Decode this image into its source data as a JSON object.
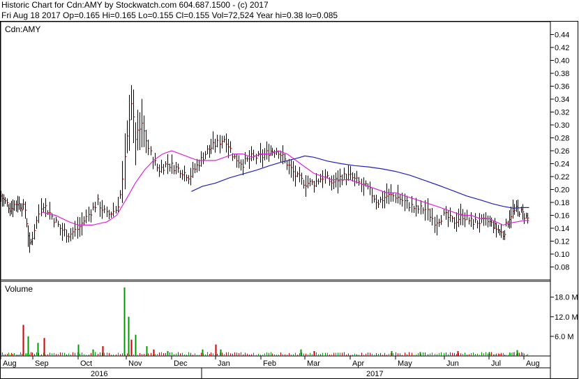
{
  "header": {
    "line1": "Historic Chart for Cdn:AMY by Stockwatch.com 604.687.1500 - (c) 2017",
    "line2": "Fri Aug 18 2017   Op=0.165  Hi=0.165  Lo=0.155  Cl=0.155  Vol=72,524  Year hi=0.38  lo=0.085"
  },
  "chart_data": {
    "type": "ohlc",
    "symbol_label": "Cdn:AMY",
    "volume_label": "Volume",
    "price_axis": {
      "ylim": [
        0.06,
        0.46
      ],
      "ticks": [
        "0.44",
        "0.42",
        "0.40",
        "0.38",
        "0.36",
        "0.34",
        "0.32",
        "0.30",
        "0.28",
        "0.26",
        "0.24",
        "0.22",
        "0.20",
        "0.18",
        "0.16",
        "0.14",
        "0.12",
        "0.10",
        "0.08"
      ]
    },
    "volume_axis": {
      "ylim": [
        0,
        22
      ],
      "ticks": [
        "18.0 M",
        "12.0 M",
        "6.0 M"
      ]
    },
    "x_axis": {
      "months": [
        "Aug",
        "Sep",
        "Oct",
        "Nov",
        "Dec",
        "Jan",
        "Feb",
        "Mar",
        "Apr",
        "May",
        "Jun",
        "Jul",
        "Aug"
      ],
      "years": [
        "2016",
        "2017"
      ]
    },
    "colors": {
      "up_bar": "#000000",
      "down_tick": "#cc0000",
      "ma_short": "#e020e0",
      "ma_long": "#2020c0",
      "volume_up": "#009900",
      "volume_down": "#cc0000"
    },
    "price_anchors_month_value": [
      [
        0.0,
        0.19
      ],
      [
        0.3,
        0.17
      ],
      [
        0.5,
        0.18
      ],
      [
        0.75,
        0.17
      ],
      [
        0.9,
        0.11
      ],
      [
        1.0,
        0.13
      ],
      [
        1.2,
        0.18
      ],
      [
        1.4,
        0.16
      ],
      [
        1.6,
        0.14
      ],
      [
        1.8,
        0.13
      ],
      [
        2.0,
        0.14
      ],
      [
        2.2,
        0.16
      ],
      [
        2.4,
        0.18
      ],
      [
        2.6,
        0.16
      ],
      [
        2.8,
        0.17
      ],
      [
        2.9,
        0.2
      ],
      [
        3.0,
        0.27
      ],
      [
        3.1,
        0.34
      ],
      [
        3.2,
        0.28
      ],
      [
        3.35,
        0.3
      ],
      [
        3.5,
        0.26
      ],
      [
        3.7,
        0.23
      ],
      [
        3.9,
        0.24
      ],
      [
        4.2,
        0.23
      ],
      [
        4.4,
        0.22
      ],
      [
        4.6,
        0.24
      ],
      [
        4.8,
        0.26
      ],
      [
        5.0,
        0.27
      ],
      [
        5.2,
        0.28
      ],
      [
        5.4,
        0.25
      ],
      [
        5.6,
        0.24
      ],
      [
        5.8,
        0.25
      ],
      [
        6.0,
        0.25
      ],
      [
        6.2,
        0.26
      ],
      [
        6.4,
        0.26
      ],
      [
        6.6,
        0.24
      ],
      [
        6.8,
        0.22
      ],
      [
        7.0,
        0.21
      ],
      [
        7.2,
        0.21
      ],
      [
        7.4,
        0.22
      ],
      [
        7.6,
        0.21
      ],
      [
        7.8,
        0.22
      ],
      [
        8.0,
        0.22
      ],
      [
        8.2,
        0.21
      ],
      [
        8.4,
        0.2
      ],
      [
        8.6,
        0.18
      ],
      [
        8.8,
        0.19
      ],
      [
        9.0,
        0.19
      ],
      [
        9.2,
        0.18
      ],
      [
        9.4,
        0.17
      ],
      [
        9.6,
        0.17
      ],
      [
        9.8,
        0.15
      ],
      [
        10.0,
        0.16
      ],
      [
        10.2,
        0.15
      ],
      [
        10.4,
        0.16
      ],
      [
        10.6,
        0.15
      ],
      [
        10.8,
        0.15
      ],
      [
        11.0,
        0.15
      ],
      [
        11.2,
        0.14
      ],
      [
        11.4,
        0.13
      ],
      [
        11.6,
        0.16
      ],
      [
        11.8,
        0.17
      ],
      [
        12.0,
        0.16
      ],
      [
        12.1,
        0.155
      ]
    ],
    "ma_short_month_value": [
      [
        1.2,
        0.165
      ],
      [
        1.5,
        0.16
      ],
      [
        1.8,
        0.15
      ],
      [
        2.0,
        0.145
      ],
      [
        2.3,
        0.145
      ],
      [
        2.6,
        0.15
      ],
      [
        2.8,
        0.16
      ],
      [
        3.0,
        0.185
      ],
      [
        3.2,
        0.21
      ],
      [
        3.4,
        0.23
      ],
      [
        3.6,
        0.245
      ],
      [
        3.8,
        0.255
      ],
      [
        4.0,
        0.26
      ],
      [
        4.2,
        0.255
      ],
      [
        4.4,
        0.25
      ],
      [
        4.6,
        0.245
      ],
      [
        4.8,
        0.245
      ],
      [
        5.0,
        0.245
      ],
      [
        5.2,
        0.25
      ],
      [
        5.4,
        0.255
      ],
      [
        5.6,
        0.255
      ],
      [
        5.8,
        0.25
      ],
      [
        6.0,
        0.255
      ],
      [
        6.2,
        0.255
      ],
      [
        6.4,
        0.26
      ],
      [
        6.6,
        0.255
      ],
      [
        6.8,
        0.245
      ],
      [
        7.0,
        0.235
      ],
      [
        7.2,
        0.225
      ],
      [
        7.4,
        0.22
      ],
      [
        7.6,
        0.215
      ],
      [
        7.8,
        0.215
      ],
      [
        8.0,
        0.215
      ],
      [
        8.2,
        0.21
      ],
      [
        8.4,
        0.205
      ],
      [
        8.6,
        0.2
      ],
      [
        8.8,
        0.195
      ],
      [
        9.0,
        0.195
      ],
      [
        9.2,
        0.19
      ],
      [
        9.4,
        0.185
      ],
      [
        9.6,
        0.18
      ],
      [
        9.8,
        0.175
      ],
      [
        10.0,
        0.17
      ],
      [
        10.2,
        0.165
      ],
      [
        10.4,
        0.16
      ],
      [
        10.6,
        0.16
      ],
      [
        10.8,
        0.155
      ],
      [
        11.0,
        0.155
      ],
      [
        11.2,
        0.15
      ],
      [
        11.4,
        0.145
      ],
      [
        11.6,
        0.148
      ],
      [
        11.8,
        0.15
      ],
      [
        12.0,
        0.152
      ],
      [
        12.15,
        0.152
      ]
    ],
    "ma_long_month_value": [
      [
        4.45,
        0.197
      ],
      [
        4.7,
        0.205
      ],
      [
        5.0,
        0.21
      ],
      [
        5.3,
        0.218
      ],
      [
        5.6,
        0.224
      ],
      [
        5.9,
        0.23
      ],
      [
        6.2,
        0.237
      ],
      [
        6.5,
        0.243
      ],
      [
        6.8,
        0.248
      ],
      [
        7.0,
        0.252
      ],
      [
        7.2,
        0.25
      ],
      [
        7.5,
        0.244
      ],
      [
        7.8,
        0.24
      ],
      [
        8.1,
        0.237
      ],
      [
        8.4,
        0.235
      ],
      [
        8.7,
        0.232
      ],
      [
        9.0,
        0.228
      ],
      [
        9.3,
        0.222
      ],
      [
        9.6,
        0.214
      ],
      [
        9.9,
        0.206
      ],
      [
        10.2,
        0.198
      ],
      [
        10.5,
        0.19
      ],
      [
        10.8,
        0.184
      ],
      [
        11.1,
        0.178
      ],
      [
        11.4,
        0.174
      ],
      [
        11.7,
        0.171
      ],
      [
        12.0,
        0.172
      ],
      [
        12.15,
        0.172
      ]
    ],
    "volume_spikes_month_value": [
      [
        0.7,
        9.5
      ],
      [
        0.85,
        6.0
      ],
      [
        1.1,
        4.0
      ],
      [
        1.25,
        5.5
      ],
      [
        2.0,
        3.5
      ],
      [
        2.3,
        2.0
      ],
      [
        2.5,
        3.0
      ],
      [
        2.95,
        21.0
      ],
      [
        3.05,
        12.0
      ],
      [
        3.1,
        5.0
      ],
      [
        3.2,
        6.5
      ],
      [
        3.45,
        3.0
      ],
      [
        3.6,
        2.0
      ],
      [
        3.9,
        1.5
      ],
      [
        4.7,
        2.0
      ],
      [
        5.0,
        3.5
      ],
      [
        5.1,
        2.0
      ],
      [
        6.9,
        2.0
      ],
      [
        7.2,
        1.5
      ],
      [
        8.9,
        1.5
      ],
      [
        9.5,
        1.2
      ],
      [
        10.3,
        1.5
      ],
      [
        11.0,
        1.2
      ],
      [
        11.8,
        1.8
      ]
    ]
  }
}
